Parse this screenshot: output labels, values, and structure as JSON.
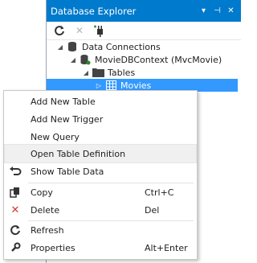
{
  "explorer": {
    "title": "Database Explorer",
    "tree": {
      "data_connections": "Data Connections",
      "connection": "MovieDBContext (MvcMovie)",
      "tables": "Tables",
      "movies": "Movies"
    },
    "colors": {
      "title_bg": "#007acc",
      "selection": "#3399ff"
    }
  },
  "menu": {
    "add_new_table": "Add New Table",
    "add_new_trigger": "Add New Trigger",
    "new_query": "New Query",
    "open_table_definition": "Open Table Definition",
    "show_table_data": "Show Table Data",
    "copy": "Copy",
    "copy_shortcut": "Ctrl+C",
    "delete": "Delete",
    "delete_shortcut": "Del",
    "refresh": "Refresh",
    "properties": "Properties",
    "properties_shortcut": "Alt+Enter"
  }
}
